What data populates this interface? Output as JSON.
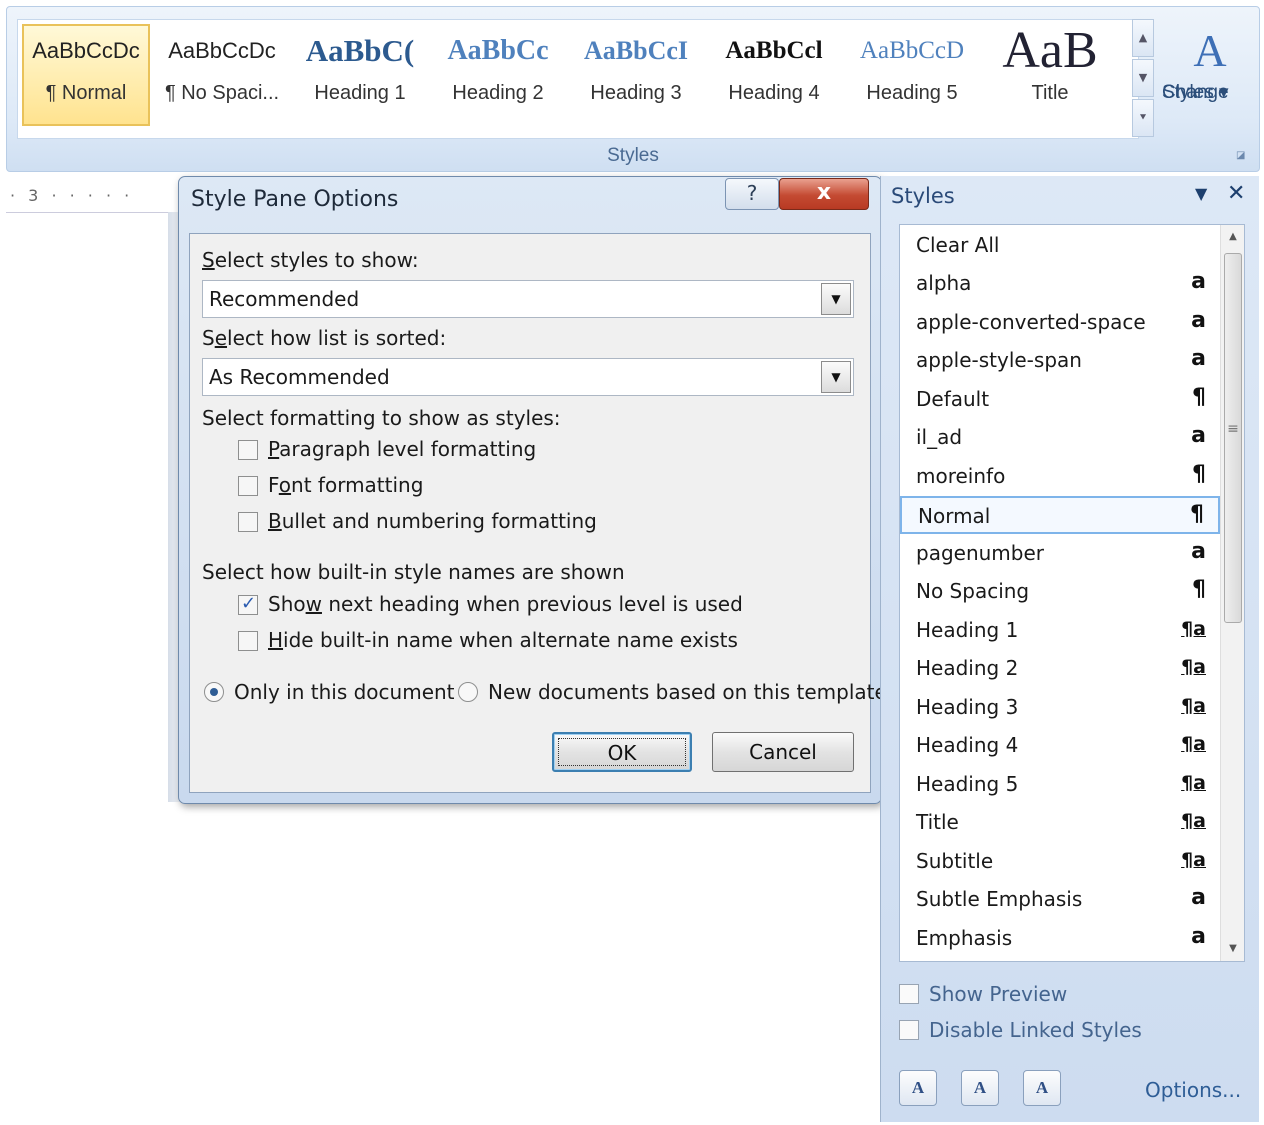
{
  "ribbon": {
    "group_label": "Styles",
    "gallery": [
      {
        "sample": "AaBbCcDc",
        "name": "¶ Normal",
        "selected": true
      },
      {
        "sample": "AaBbCcDc",
        "name": "¶ No Spaci..."
      },
      {
        "sample": "AaBbC(",
        "name": "Heading 1"
      },
      {
        "sample": "AaBbCc",
        "name": "Heading 2"
      },
      {
        "sample": "AaBbCcI",
        "name": "Heading 3"
      },
      {
        "sample": "AaBbCcl",
        "name": "Heading 4"
      },
      {
        "sample": "AaBbCcD",
        "name": "Heading 5"
      },
      {
        "sample": "AaB",
        "name": "Title"
      }
    ],
    "change_styles": {
      "line1": "Change",
      "line2": "Styles ▾"
    }
  },
  "ruler": {
    "text": "· 3 · · · · ·"
  },
  "dialog": {
    "title": "Style Pane Options",
    "help": "?",
    "close": "x",
    "show_label": {
      "pre": "",
      "u": "S",
      "post": "elect styles to show:"
    },
    "show_value": "Recommended",
    "sort_label": {
      "pre": "S",
      "u": "e",
      "post": "lect how list is sorted:"
    },
    "sort_value": "As Recommended",
    "formatting_label": "Select formatting to show as styles:",
    "cb_paragraph": {
      "pre": "",
      "u": "P",
      "post": "aragraph level formatting",
      "checked": false
    },
    "cb_font": {
      "pre": "F",
      "u": "o",
      "post": "nt formatting",
      "checked": false
    },
    "cb_bullet": {
      "pre": "",
      "u": "B",
      "post": "ullet and numbering formatting",
      "checked": false
    },
    "builtin_label": "Select how built-in style names are shown",
    "cb_nextheading": {
      "pre": "Sho",
      "u": "w",
      "post": " next heading when previous level is used",
      "checked": true
    },
    "cb_hide": {
      "pre": "",
      "u": "H",
      "post": "ide built-in name when alternate name exists",
      "checked": false
    },
    "radio_only": "Only in this document",
    "radio_new": "New documents based on this template",
    "ok": "OK",
    "cancel": "Cancel"
  },
  "pane": {
    "title": "Styles",
    "menu_icon": "▼",
    "close_icon": "✕",
    "items": [
      {
        "name": "Clear All",
        "mark": ""
      },
      {
        "name": "alpha",
        "mark": "a"
      },
      {
        "name": "apple-converted-space",
        "mark": "a"
      },
      {
        "name": "apple-style-span",
        "mark": "a"
      },
      {
        "name": "Default",
        "mark": "¶"
      },
      {
        "name": "il_ad",
        "mark": "a"
      },
      {
        "name": "moreinfo",
        "mark": "¶"
      },
      {
        "name": "Normal",
        "mark": "¶",
        "selected": true
      },
      {
        "name": "pagenumber",
        "mark": "a"
      },
      {
        "name": "No Spacing",
        "mark": "¶"
      },
      {
        "name": "Heading 1",
        "mark": "¶a"
      },
      {
        "name": "Heading 2",
        "mark": "¶a"
      },
      {
        "name": "Heading 3",
        "mark": "¶a"
      },
      {
        "name": "Heading 4",
        "mark": "¶a"
      },
      {
        "name": "Heading 5",
        "mark": "¶a"
      },
      {
        "name": "Title",
        "mark": "¶a"
      },
      {
        "name": "Subtitle",
        "mark": "¶a"
      },
      {
        "name": "Subtle Emphasis",
        "mark": "a"
      },
      {
        "name": "Emphasis",
        "mark": "a"
      }
    ],
    "show_preview": "Show Preview",
    "disable_linked": "Disable Linked Styles",
    "options_link": "Options..."
  }
}
